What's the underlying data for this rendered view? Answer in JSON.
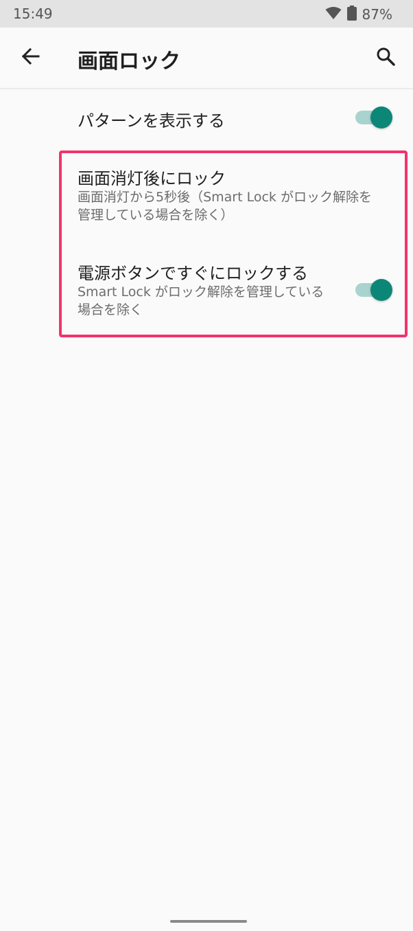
{
  "status_bar": {
    "time": "15:49",
    "battery_percent": "87%",
    "icons": [
      "wifi-icon",
      "battery-icon"
    ]
  },
  "app_bar": {
    "title": "画面ロック",
    "icons": [
      "back-arrow-icon",
      "search-icon"
    ]
  },
  "settings": [
    {
      "title": "パターンを表示する",
      "subtitle": "",
      "toggle_on": true
    },
    {
      "title": "画面消灯後にロック",
      "subtitle": "画面消灯から5秒後（Smart Lock がロック解除を管理している場合を除く）"
    },
    {
      "title": "電源ボタンですぐにロックする",
      "subtitle": "Smart Lock がロック解除を管理している場合を除く",
      "toggle_on": true
    }
  ],
  "colors": {
    "accent": "#0c8777",
    "track": "#a9d3cf",
    "highlight": "#f2336b",
    "background": "#fafafa",
    "status_bar": "#e3e3e3"
  }
}
